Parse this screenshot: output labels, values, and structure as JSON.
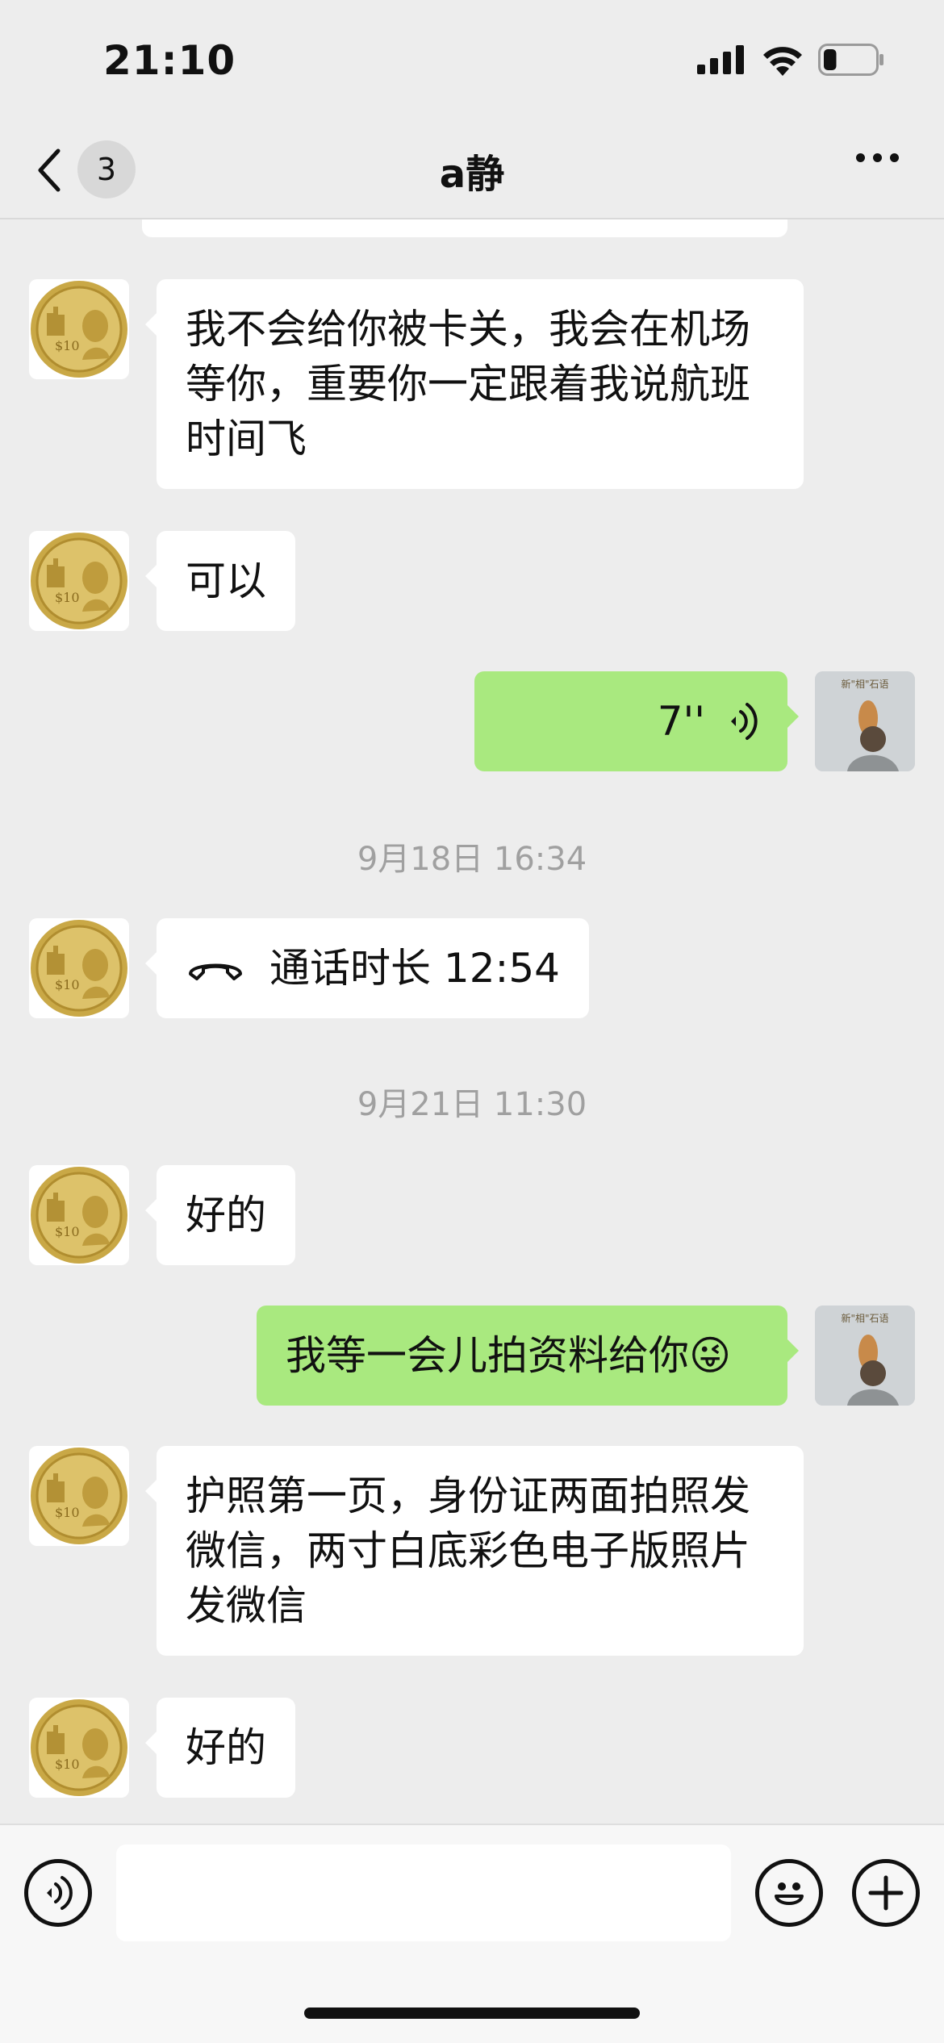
{
  "status_bar": {
    "time": "21:10",
    "battery_level": 0.25
  },
  "nav": {
    "unread_count": "3",
    "title": "a静"
  },
  "messages": [
    {
      "side": "left",
      "kind": "text",
      "text": "我不会给你被卡关，我会在机场等你，重要你一定跟着我说航班时间飞"
    },
    {
      "side": "left",
      "kind": "text",
      "text": "可以"
    },
    {
      "side": "right",
      "kind": "voice",
      "duration": "7''"
    },
    {
      "kind": "timestamp",
      "text": "9月18日 16:34"
    },
    {
      "side": "left",
      "kind": "call",
      "text": "通话时长 12:54"
    },
    {
      "kind": "timestamp",
      "text": "9月21日 11:30"
    },
    {
      "side": "left",
      "kind": "text",
      "text": "好的"
    },
    {
      "side": "right",
      "kind": "text",
      "text": "我等一会儿拍资料给你😜"
    },
    {
      "side": "left",
      "kind": "text",
      "text": "护照第一页，身份证两面拍照发微信，两寸白底彩色电子版照片发微信"
    },
    {
      "side": "left",
      "kind": "text",
      "text": "好的"
    }
  ],
  "avatar_right_caption": "新\"相\"石语",
  "colors": {
    "background": "#ededed",
    "outgoing_bubble": "#a9e97f",
    "incoming_bubble": "#ffffff"
  },
  "input_bar": {
    "value": "",
    "icons": [
      "voice-input-icon",
      "emoji-icon",
      "plus-icon"
    ]
  }
}
